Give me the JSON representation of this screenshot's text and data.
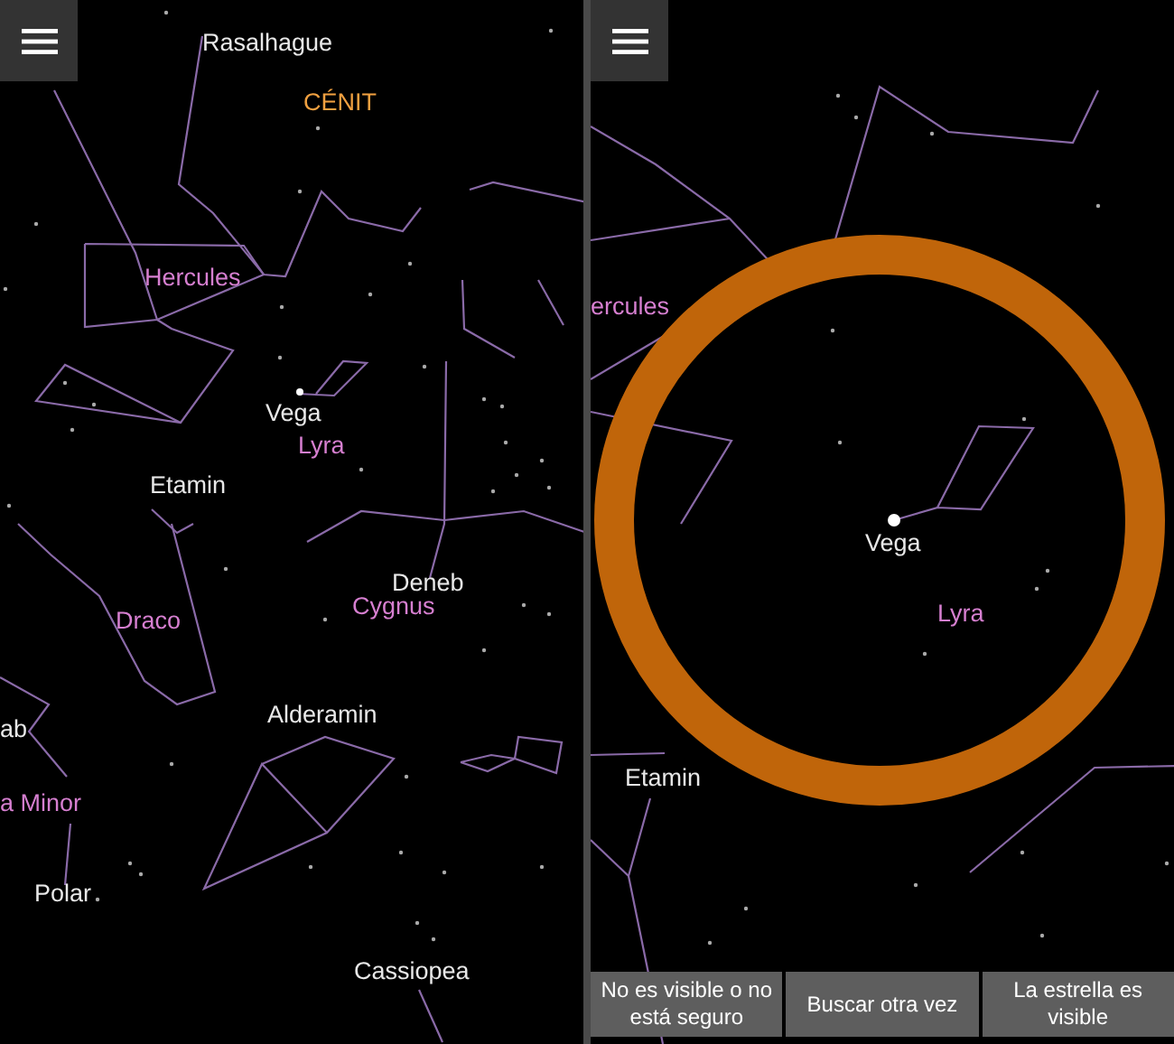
{
  "panels": [
    {
      "labels": [
        {
          "text": "Rasalhague",
          "kind": "star"
        },
        {
          "text": "CÉNIT",
          "kind": "zenith"
        },
        {
          "text": "Hercules",
          "kind": "constellation"
        },
        {
          "text": "Vega",
          "kind": "star"
        },
        {
          "text": "Lyra",
          "kind": "constellation"
        },
        {
          "text": "Etamin",
          "kind": "star"
        },
        {
          "text": "Deneb",
          "kind": "star"
        },
        {
          "text": "Cygnus",
          "kind": "constellation"
        },
        {
          "text": "Draco",
          "kind": "constellation"
        },
        {
          "text": "ab",
          "kind": "star"
        },
        {
          "text": "a Minor",
          "kind": "constellation"
        },
        {
          "text": "Alderamin",
          "kind": "star"
        },
        {
          "text": "Polar",
          "kind": "star"
        },
        {
          "text": "Cassiopea",
          "kind": "star"
        }
      ]
    },
    {
      "target_ring": true,
      "labels": [
        {
          "text": "ercules",
          "kind": "constellation"
        },
        {
          "text": "Vega",
          "kind": "star"
        },
        {
          "text": "Lyra",
          "kind": "constellation"
        },
        {
          "text": "Etamin",
          "kind": "star"
        }
      ],
      "buttons": [
        "No es visible o no está seguro",
        "Buscar otra vez",
        "La estrella es visible"
      ]
    }
  ]
}
